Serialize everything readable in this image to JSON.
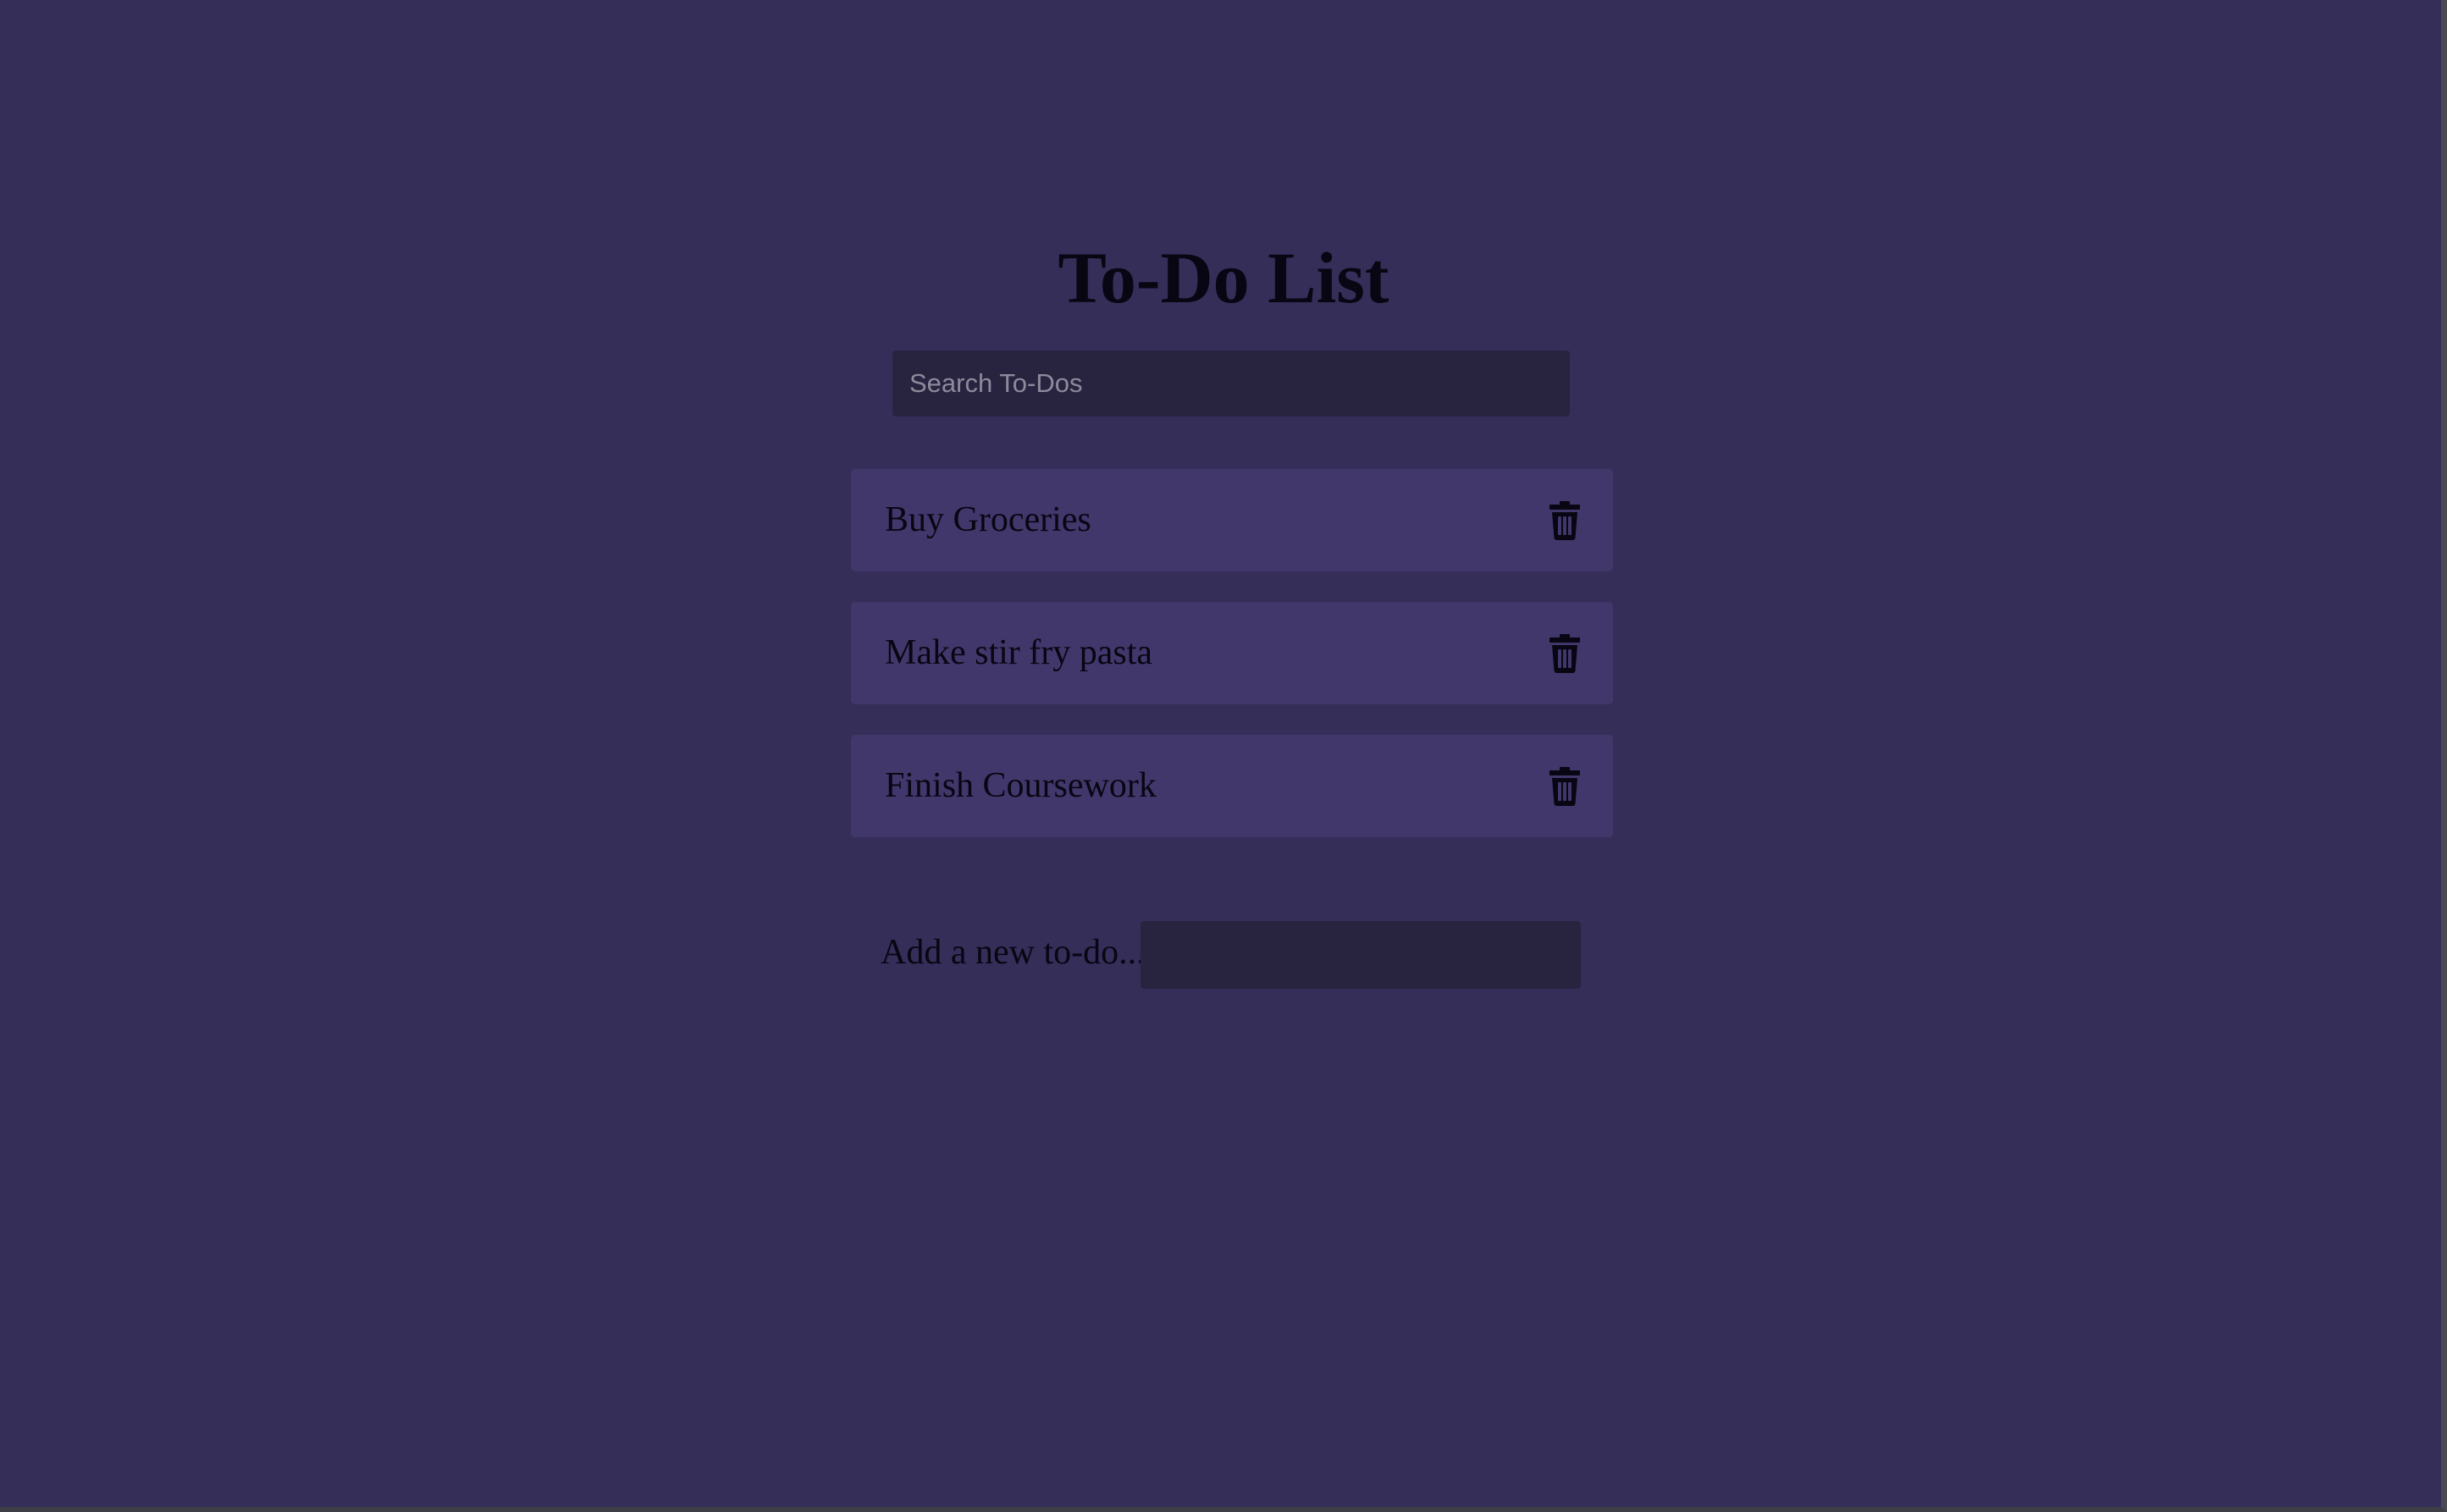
{
  "header": {
    "title": "To-Do List"
  },
  "search": {
    "placeholder": "Search To-Dos",
    "value": ""
  },
  "todos": [
    {
      "text": "Buy Groceries",
      "icon": "trash-icon"
    },
    {
      "text": "Make stir fry pasta",
      "icon": "trash-icon"
    },
    {
      "text": "Finish Coursework",
      "icon": "trash-icon"
    }
  ],
  "add_form": {
    "label": "Add a new to-do...",
    "value": ""
  },
  "colors": {
    "background": "#352e59",
    "item_background": "#42376b",
    "input_background": "#282440",
    "text": "#070612"
  }
}
